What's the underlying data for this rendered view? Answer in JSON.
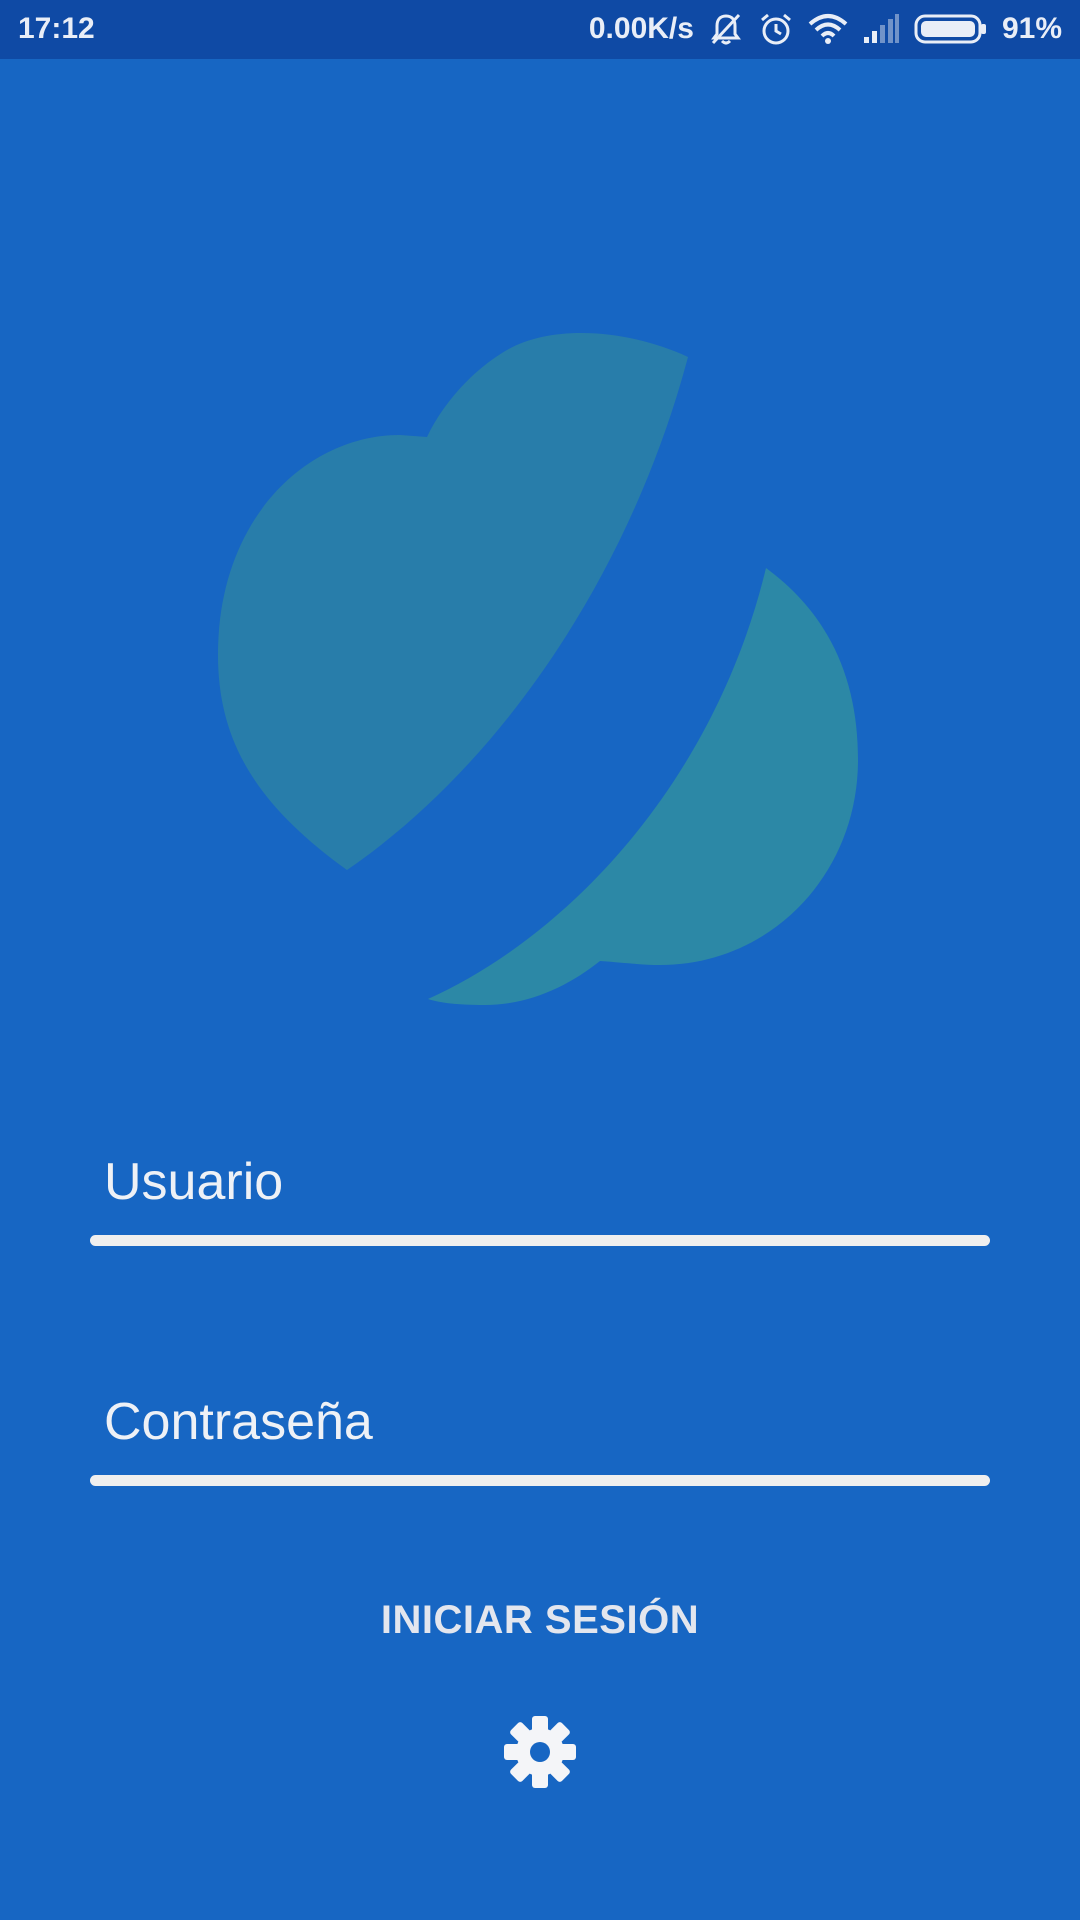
{
  "status_bar": {
    "time": "17:12",
    "network_speed": "0.00K/s",
    "battery_percent": "91%",
    "icons": [
      "notifications-muted-icon",
      "alarm-icon",
      "wifi-icon",
      "signal-icon",
      "battery-icon"
    ]
  },
  "login": {
    "username_placeholder": "Usuario",
    "username_value": "",
    "password_placeholder": "Contraseña",
    "password_value": "",
    "submit_label": "INICIAR SESIÓN",
    "settings_icon": "gear-icon"
  },
  "colors": {
    "background": "#1766c3",
    "status_bar": "#0f4aa5",
    "logo": "#2a7fa8",
    "underline": "#efefef",
    "text": "#f2f4f8"
  }
}
